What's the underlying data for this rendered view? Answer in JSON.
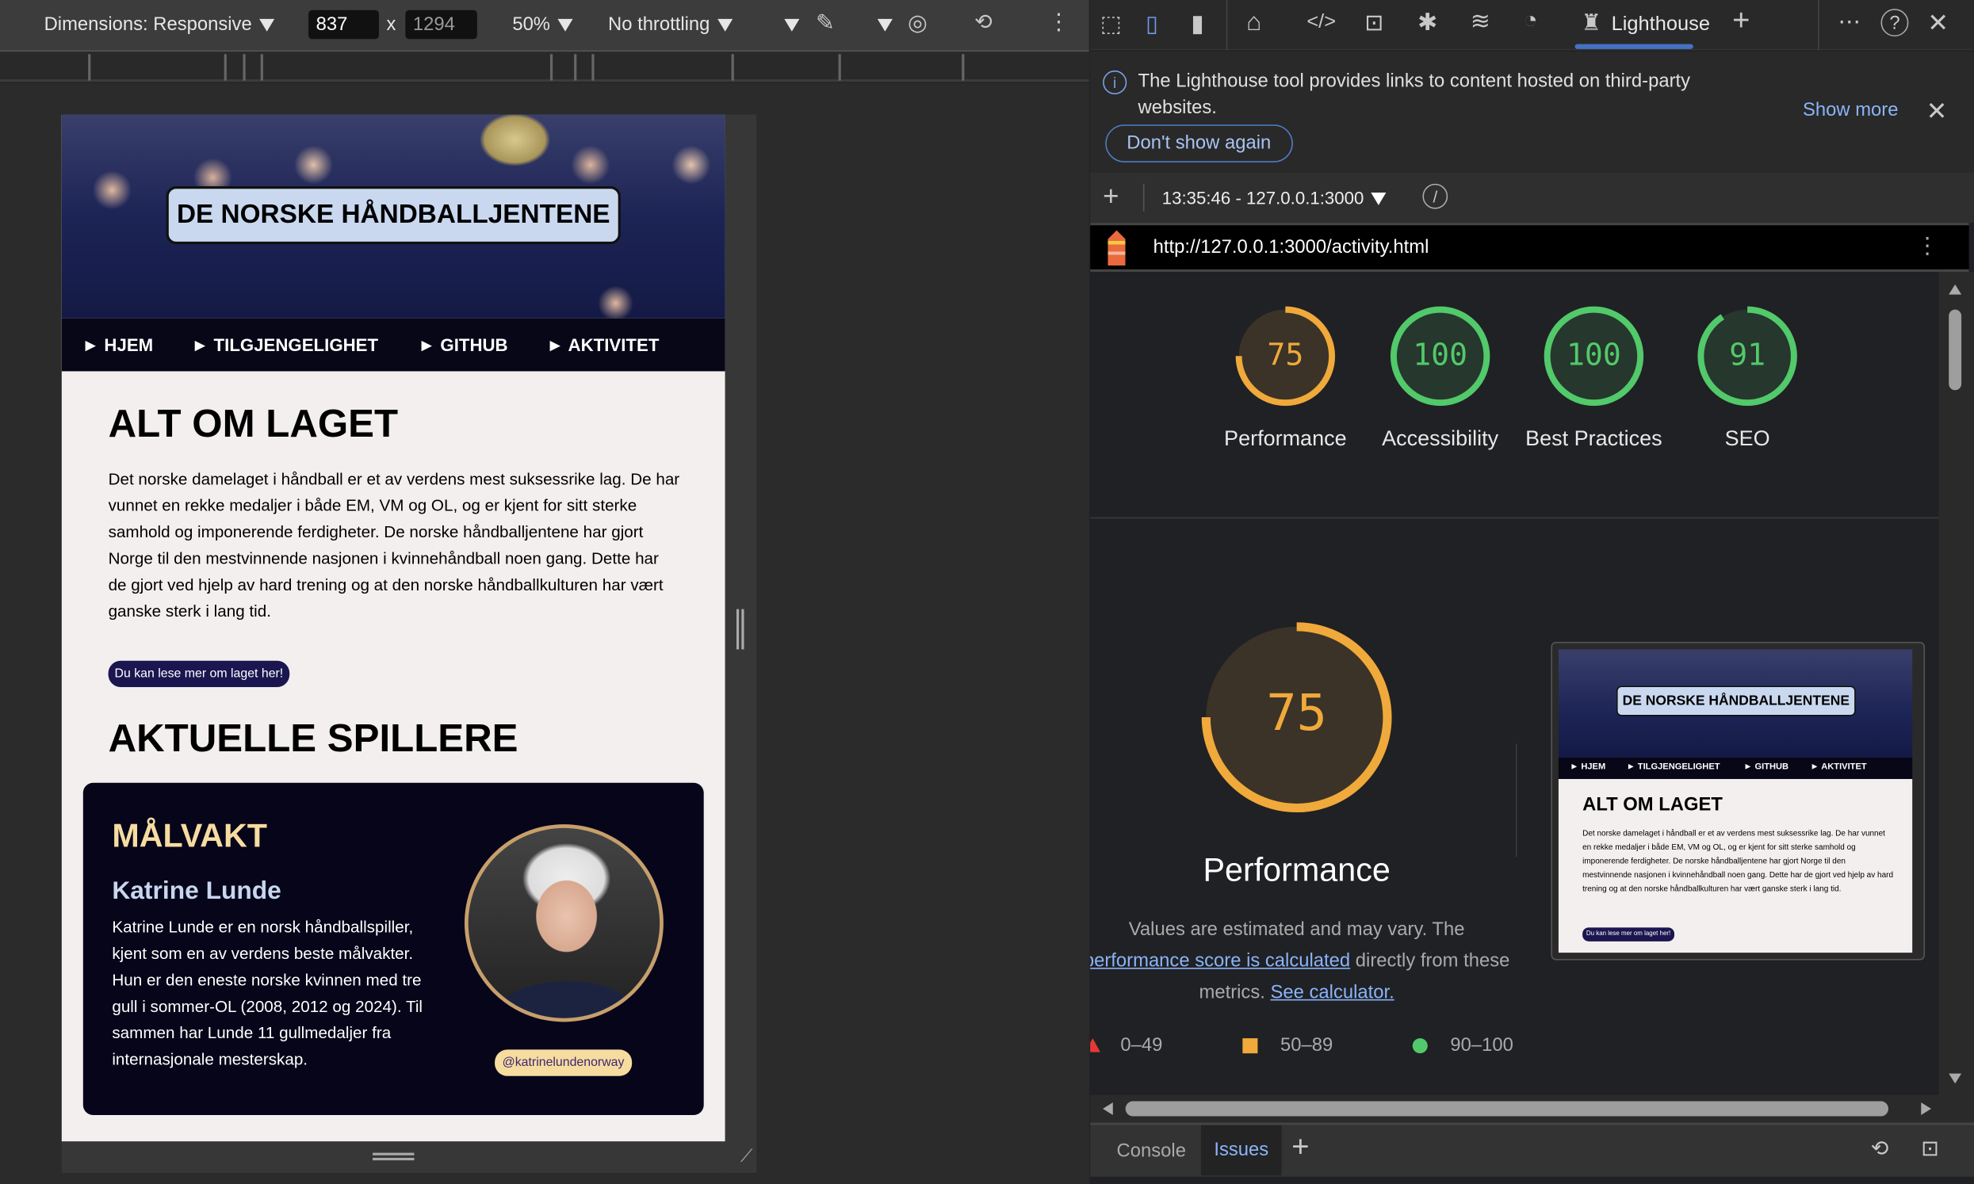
{
  "device_toolbar": {
    "dimensions": "Dimensions: Responsive",
    "width": "837",
    "times": "x",
    "height": "1294",
    "zoom": "50%",
    "throttling": "No throttling"
  },
  "page": {
    "hero_title": "DE NORSKE HÅNDBALLJENTENE",
    "nav": [
      "► HJEM",
      "► TILGJENGELIGHET",
      "► GITHUB",
      "► AKTIVITET"
    ],
    "section1_title": "ALT OM LAGET",
    "intro": "Det norske damelaget i håndball er et av verdens mest suksessrike lag. De har vunnet en rekke medaljer i både EM, VM og OL, og er kjent for sitt sterke samhold og imponerende ferdigheter. De norske håndballjentene har gjort Norge til den mestvinnende nasjonen i kvinnehåndball noen gang. Dette har de gjort ved hjelp av hard trening og at den norske håndballkulturen har vært ganske sterk i lang tid.",
    "more_button": "Du kan lese mer om laget her!",
    "section2_title": "AKTUELLE SPILLERE",
    "player": {
      "role": "MÅLVAKT",
      "name": "Katrine Lunde",
      "bio": "Katrine Lunde er en norsk håndballspiller, kjent som en av verdens beste målvakter. Hun er den eneste norske kvinnen med tre gull i sommer-OL (2008, 2012 og 2024). Til sammen har Lunde 11 gullmedaljer fra internasjonale mesterskap.",
      "handle": "@katrinelundenorway"
    }
  },
  "devtools": {
    "active_tab": "Lighthouse",
    "info_text": "The Lighthouse tool provides links to content hosted on third-party websites.",
    "show_more": "Show more",
    "dont_show": "Don't show again",
    "report_select": "13:35:46 - 127.0.0.1:3000",
    "url": "http://127.0.0.1:3000/activity.html",
    "scores": [
      {
        "label": "Performance",
        "value": "75",
        "color": "#f0a93b"
      },
      {
        "label": "Accessibility",
        "value": "100",
        "color": "#52c96a"
      },
      {
        "label": "Best Practices",
        "value": "100",
        "color": "#52c96a"
      },
      {
        "label": "SEO",
        "value": "91",
        "color": "#52c96a"
      }
    ],
    "perf_title": "Performance",
    "desc1": "Values are estimated and may vary. The",
    "desc_link": "performance score is calculated",
    "desc2": "directly from these",
    "desc3": "metrics.",
    "calc_link": "See calculator.",
    "legend": [
      "0–49",
      "50–89",
      "90–100"
    ],
    "drawer_tabs": [
      "Console",
      "Issues"
    ]
  }
}
